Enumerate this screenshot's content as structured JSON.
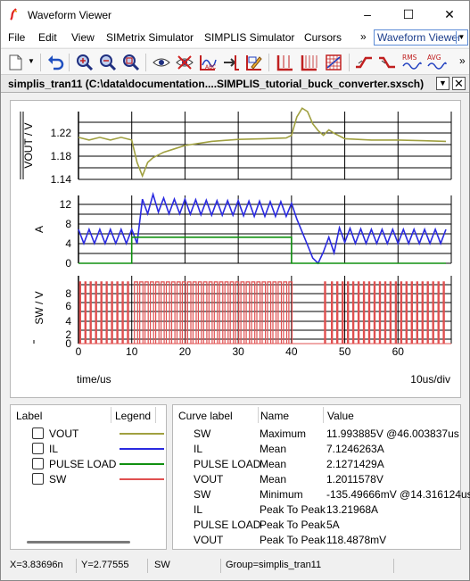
{
  "window": {
    "title": "Waveform Viewer",
    "minimize": "–",
    "maximize": "☐",
    "close": "✕"
  },
  "menu": {
    "items": [
      "File",
      "Edit",
      "View",
      "SIMetrix Simulator",
      "SIMPLIS Simulator",
      "Cursors"
    ],
    "overflow": "»",
    "selector_value": "Waveform Viewer"
  },
  "toolbar": {
    "icons": [
      "new-icon",
      "undo-icon",
      "zoom-in-icon",
      "zoom-out-icon",
      "zoom-fit-icon",
      "show-icon",
      "hide-icon",
      "add-curve-icon",
      "move-curve-icon",
      "edit-curve-icon",
      "grid-icon",
      "grid-fine-icon",
      "grid-dense-icon",
      "rise-icon",
      "fall-icon",
      "rms-icon",
      "avg-icon"
    ],
    "rms_label": "RMS",
    "avg_label": "AVG",
    "overflow": "»"
  },
  "document": {
    "title": "simplis_tran11 (C:\\data\\documentation....SIMPLIS_tutorial_buck_converter.sxsch)"
  },
  "colors": {
    "vout": "#a0a040",
    "il": "#2a2ae0",
    "pulse": "#109010",
    "sw": "#e05050"
  },
  "chart_data": [
    {
      "type": "line",
      "ylabel": "VOUT / V",
      "ylim": [
        1.14,
        1.24
      ],
      "yticks": [
        "1.22",
        "1.18",
        "1.14"
      ],
      "series": [
        {
          "name": "VOUT",
          "x": [
            0,
            2,
            4,
            6,
            8,
            10,
            11,
            12,
            13,
            14,
            16,
            18,
            20,
            25,
            30,
            35,
            39,
            40,
            41,
            42,
            43,
            44,
            45,
            46,
            47,
            48,
            50,
            55,
            60,
            65,
            69
          ],
          "values": [
            1.202,
            1.198,
            1.202,
            1.198,
            1.202,
            1.198,
            1.165,
            1.145,
            1.165,
            1.172,
            1.18,
            1.185,
            1.19,
            1.196,
            1.199,
            1.2,
            1.201,
            1.205,
            1.232,
            1.245,
            1.24,
            1.222,
            1.212,
            1.205,
            1.213,
            1.208,
            1.2,
            1.198,
            1.198,
            1.197,
            1.196
          ]
        }
      ]
    },
    {
      "type": "line",
      "ylabel": "A",
      "ylim": [
        0,
        13
      ],
      "yticks": [
        "12",
        "8",
        "4",
        "0"
      ],
      "series": [
        {
          "name": "IL",
          "x": [
            0,
            1,
            2,
            3,
            4,
            5,
            6,
            7,
            8,
            9,
            10,
            11,
            12,
            13,
            14,
            15,
            16,
            17,
            18,
            19,
            20,
            21,
            22,
            23,
            24,
            25,
            26,
            27,
            28,
            29,
            30,
            31,
            32,
            33,
            34,
            35,
            36,
            37,
            38,
            39,
            40,
            41,
            42,
            43,
            44,
            45,
            46,
            47,
            48,
            49,
            50,
            51,
            52,
            53,
            54,
            55,
            56,
            57,
            58,
            59,
            60,
            61,
            62,
            63,
            64,
            65,
            66,
            67,
            68,
            69
          ],
          "values": [
            6.5,
            3.8,
            6.5,
            3.8,
            6.5,
            3.8,
            6.5,
            3.8,
            6.5,
            3.8,
            6.5,
            3.8,
            12.3,
            9.5,
            13.2,
            9.8,
            12.5,
            9.5,
            12.3,
            9.5,
            12.3,
            9.4,
            12.2,
            9.3,
            12.1,
            9.2,
            12,
            9.2,
            12,
            9.2,
            12,
            9.1,
            11.9,
            9,
            11.9,
            9,
            11.8,
            9,
            11.8,
            9,
            11.5,
            8.5,
            6,
            3.5,
            1,
            0,
            2.2,
            5,
            2,
            6.8,
            4,
            6.7,
            3.8,
            6.6,
            3.8,
            6.5,
            3.8,
            6.5,
            3.8,
            6.5,
            3.8,
            6.5,
            3.8,
            6.5,
            3.8,
            6.5,
            3.8,
            6.5,
            3.8,
            6.5
          ]
        },
        {
          "name": "PULSE LOAD",
          "x": [
            0,
            10,
            10,
            40,
            40,
            69
          ],
          "values": [
            0,
            0,
            5,
            5,
            0,
            0
          ]
        }
      ]
    },
    {
      "type": "line",
      "ylabel": "SW / V",
      "ylim": [
        0,
        11
      ],
      "yticks": [
        "8",
        "6",
        "4",
        "2",
        "0"
      ],
      "xlim": [
        0,
        70
      ],
      "xticks": [
        "0",
        "10",
        "20",
        "30",
        "40",
        "50",
        "60"
      ],
      "xlabel": "time/us",
      "xdiv": "10us/div",
      "series": [
        {
          "name": "SW",
          "pulses_start": [
            0.2,
            1.2,
            2.2,
            3.2,
            4.2,
            5.2,
            6.2,
            7.2,
            8.2,
            9.2,
            10.5,
            11.5,
            12.5,
            13.5,
            14.5,
            15.5,
            16.5,
            17.5,
            18.5,
            19.5,
            20.5,
            21.5,
            22.5,
            23.5,
            24.5,
            25.5,
            26.5,
            27.5,
            28.5,
            29.5,
            30.5,
            31.5,
            32.5,
            33.5,
            34.5,
            35.5,
            36.5,
            37.5,
            38.5,
            39.5,
            46.2,
            47.5,
            48.5,
            49.5,
            50.5,
            51.5,
            52.5,
            53.5,
            54.5,
            55.5,
            56.5,
            57.5,
            58.5,
            59.5,
            60.5,
            61.5,
            62.5,
            63.5,
            64.5,
            65.5,
            66.5,
            67.5,
            68.5
          ],
          "pulse_widths": [
            0.2,
            0.2,
            0.2,
            0.2,
            0.2,
            0.2,
            0.2,
            0.2,
            0.2,
            0.2,
            0.6,
            0.6,
            0.6,
            0.6,
            0.6,
            0.6,
            0.6,
            0.6,
            0.6,
            0.6,
            0.6,
            0.6,
            0.6,
            0.6,
            0.6,
            0.6,
            0.6,
            0.6,
            0.6,
            0.6,
            0.6,
            0.6,
            0.6,
            0.6,
            0.6,
            0.6,
            0.6,
            0.6,
            0.6,
            0.6,
            0.2,
            0.2,
            0.2,
            0.2,
            0.2,
            0.2,
            0.2,
            0.2,
            0.2,
            0.2,
            0.2,
            0.2,
            0.2,
            0.2,
            0.2,
            0.2,
            0.2,
            0.2,
            0.2,
            0.2,
            0.2,
            0.2,
            0.2
          ],
          "high": 10
        }
      ]
    }
  ],
  "legend": {
    "headers": {
      "label": "Label",
      "legend": "Legend"
    },
    "items": [
      {
        "label": "VOUT",
        "color": "#a0a040"
      },
      {
        "label": "IL",
        "color": "#2a2ae0"
      },
      {
        "label": "PULSE LOAD",
        "color": "#109010"
      },
      {
        "label": "SW",
        "color": "#e05050"
      }
    ]
  },
  "measurements": {
    "headers": {
      "curve": "Curve label",
      "name": "Name",
      "value": "Value"
    },
    "rows": [
      {
        "curve": "SW",
        "name": "Maximum",
        "value": "11.993885V @46.003837us"
      },
      {
        "curve": "IL",
        "name": "Mean",
        "value": "7.1246263A"
      },
      {
        "curve": "PULSE LOAD",
        "name": "Mean",
        "value": "2.1271429A"
      },
      {
        "curve": "VOUT",
        "name": "Mean",
        "value": "1.2011578V"
      },
      {
        "curve": "SW",
        "name": "Minimum",
        "value": "-135.49666mV @14.316124us"
      },
      {
        "curve": "IL",
        "name": "Peak To Peak",
        "value": "13.21968A"
      },
      {
        "curve": "PULSE LOAD",
        "name": "Peak To Peak",
        "value": "5A"
      },
      {
        "curve": "VOUT",
        "name": "Peak To Peak",
        "value": "118.4878mV"
      }
    ]
  },
  "status": {
    "x": "X=3.83696n",
    "y": "Y=2.77555",
    "curve": "SW",
    "group": "Group=simplis_tran11"
  }
}
